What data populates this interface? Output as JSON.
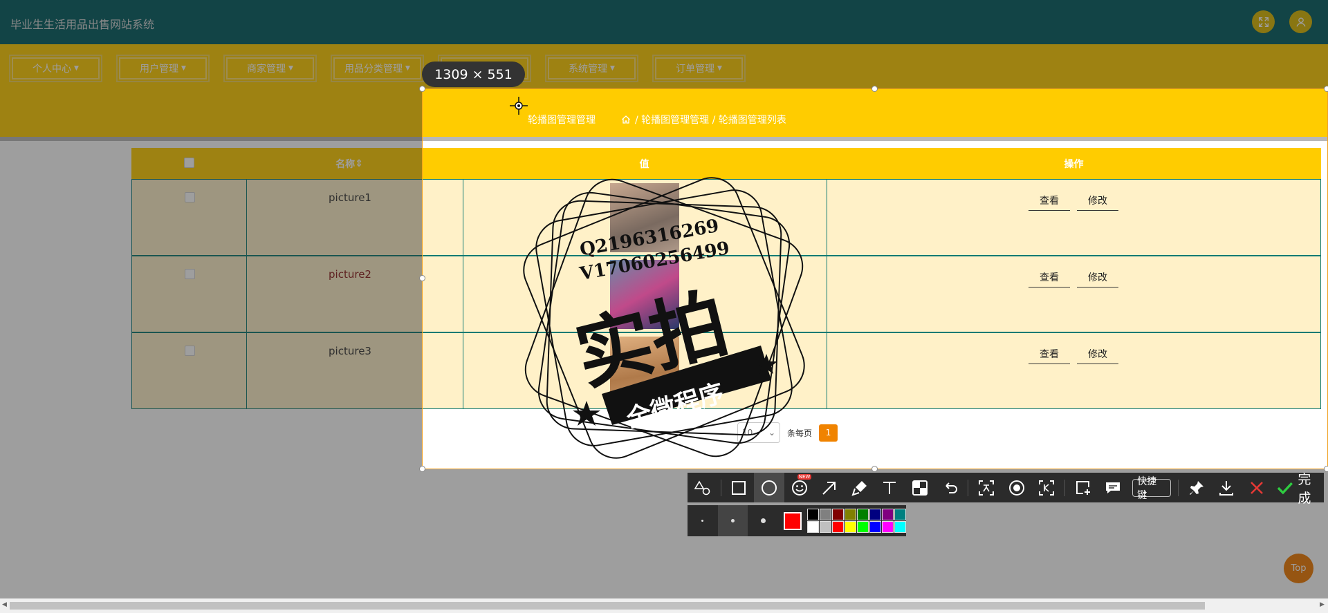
{
  "app": {
    "title": "毕业生生活用品出售网站系统"
  },
  "nav": {
    "items": [
      {
        "label": "个人中心"
      },
      {
        "label": "用户管理"
      },
      {
        "label": "商家管理"
      },
      {
        "label": "用品分类管理"
      },
      {
        "label": ""
      },
      {
        "label": "系统管理"
      },
      {
        "label": "订单管理"
      }
    ]
  },
  "breadcrumb": {
    "title": "轮播图管理管理",
    "path": "/ 轮播图管理管理 / 轮播图管理列表"
  },
  "table": {
    "headers": [
      "名称",
      "值",
      "操作"
    ],
    "sort_indicator": "⇕",
    "rows": [
      {
        "name": "picture1",
        "view": "查看",
        "edit": "修改"
      },
      {
        "name": "picture2",
        "view": "查看",
        "edit": "修改"
      },
      {
        "name": "picture3",
        "view": "查看",
        "edit": "修改"
      }
    ]
  },
  "pager": {
    "page_size": "10",
    "per_page_label": "条每页",
    "current_page": "1"
  },
  "capture": {
    "size_label": "1309 × 551"
  },
  "watermark": {
    "line1": "Q2196316269",
    "line2": "V17060256499",
    "main": "实拍",
    "ribbon": "全微程序"
  },
  "toolbar": {
    "shortcut_label": "快捷键",
    "done_label": "完成",
    "new_badge": "NEW",
    "icons": [
      "shapes-icon",
      "rectangle-icon",
      "ellipse-icon",
      "emoji-icon",
      "arrow-icon",
      "marker-icon",
      "text-icon",
      "mosaic-icon",
      "undo-icon",
      "ocr-icon",
      "record-icon",
      "long-screenshot-icon",
      "add-image-icon",
      "comment-icon",
      "pin-icon",
      "download-icon",
      "close-icon",
      "check-icon"
    ]
  },
  "palette": {
    "current": "#ff0000",
    "colors": [
      "#000000",
      "#808080",
      "#800000",
      "#808000",
      "#008000",
      "#000080",
      "#800080",
      "#008080",
      "#ffffff",
      "#c0c0c0",
      "#ff0000",
      "#ffff00",
      "#00ff00",
      "#0000ff",
      "#ff00ff",
      "#00ffff"
    ]
  },
  "scroll_top": {
    "label": "Top"
  },
  "colors": {
    "topbar": "#005b60",
    "accent": "#ffcc00",
    "row_bg": "#fff1c8",
    "pager_active": "#f08300"
  }
}
